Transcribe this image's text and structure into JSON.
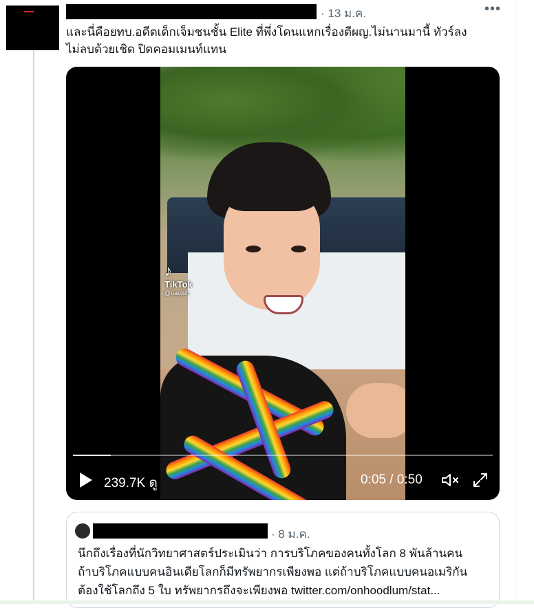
{
  "tweet": {
    "meta": "· 13 ม.ค.",
    "more_label": "•••",
    "text_lines": [
      "และนี่คือยทบ.อดีตเด็กเจ็มชนชั้น Elite ที่พึ่งโดนแหกเรื่องตีผญ.ไม่นานมานี้ ทัวร์ลง",
      "ไม่ลบด้วยเชิด ปิดคอมเมนท์แทน"
    ]
  },
  "video": {
    "watermark_logo": "♪",
    "watermark_word": "TikTok",
    "watermark_user": "@oaujuh",
    "views": "239.7K ดู",
    "time": "0:05 / 0:50",
    "progress": 0.09,
    "icons": [
      "play-icon",
      "volume-muted-icon",
      "fullscreen-icon"
    ]
  },
  "quote": {
    "meta": "· 8 ม.ค.",
    "text_lines": [
      "นึกถึงเรื่องที่นักวิทยาศาสตร์ประเมินว่า การบริโภคของคนทั้งโลก 8 พันล้านคน",
      "ถ้าบริโภคแบบคนอินเดียโลกก็มีทรัพยากรเพียงพอ แต่ถ้าบริโภคแบบคนอเมริกัน",
      "ต้องใช้โลกถึง 5 ใบ ทรัพยากรถึงจะเพียงพอ twitter.com/onhoodlum/stat..."
    ]
  }
}
